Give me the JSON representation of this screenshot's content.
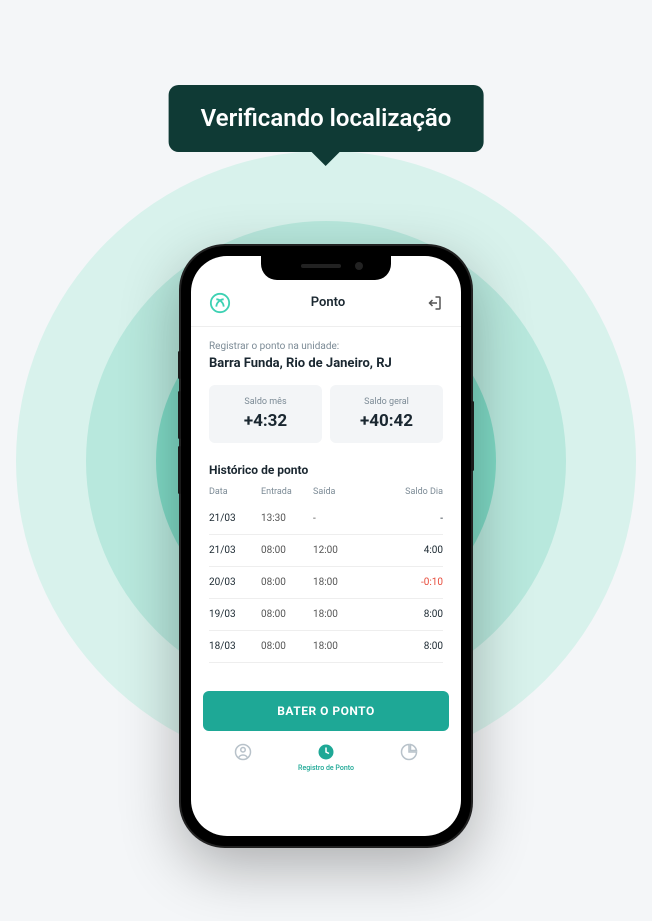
{
  "tooltip": "Verificando localização",
  "header": {
    "title": "Ponto"
  },
  "subtitle": "Registrar o ponto na unidade:",
  "location": "Barra Funda, Rio de Janeiro, RJ",
  "balance": {
    "month_label": "Saldo mês",
    "month_value": "+4:32",
    "total_label": "Saldo geral",
    "total_value": "+40:42"
  },
  "history": {
    "title": "Histórico de ponto",
    "headers": {
      "date": "Data",
      "in": "Entrada",
      "out": "Saída",
      "day": "Saldo Dia"
    },
    "rows": [
      {
        "date": "21/03",
        "in": "13:30",
        "out": "-",
        "day": "-",
        "negative": false
      },
      {
        "date": "21/03",
        "in": "08:00",
        "out": "12:00",
        "day": "4:00",
        "negative": false
      },
      {
        "date": "20/03",
        "in": "08:00",
        "out": "18:00",
        "day": "-0:10",
        "negative": true
      },
      {
        "date": "19/03",
        "in": "08:00",
        "out": "18:00",
        "day": "8:00",
        "negative": false
      },
      {
        "date": "18/03",
        "in": "08:00",
        "out": "18:00",
        "day": "8:00",
        "negative": false
      }
    ]
  },
  "primary_button": "BATER O PONTO",
  "nav": {
    "active_label": "Registro de Ponto"
  }
}
